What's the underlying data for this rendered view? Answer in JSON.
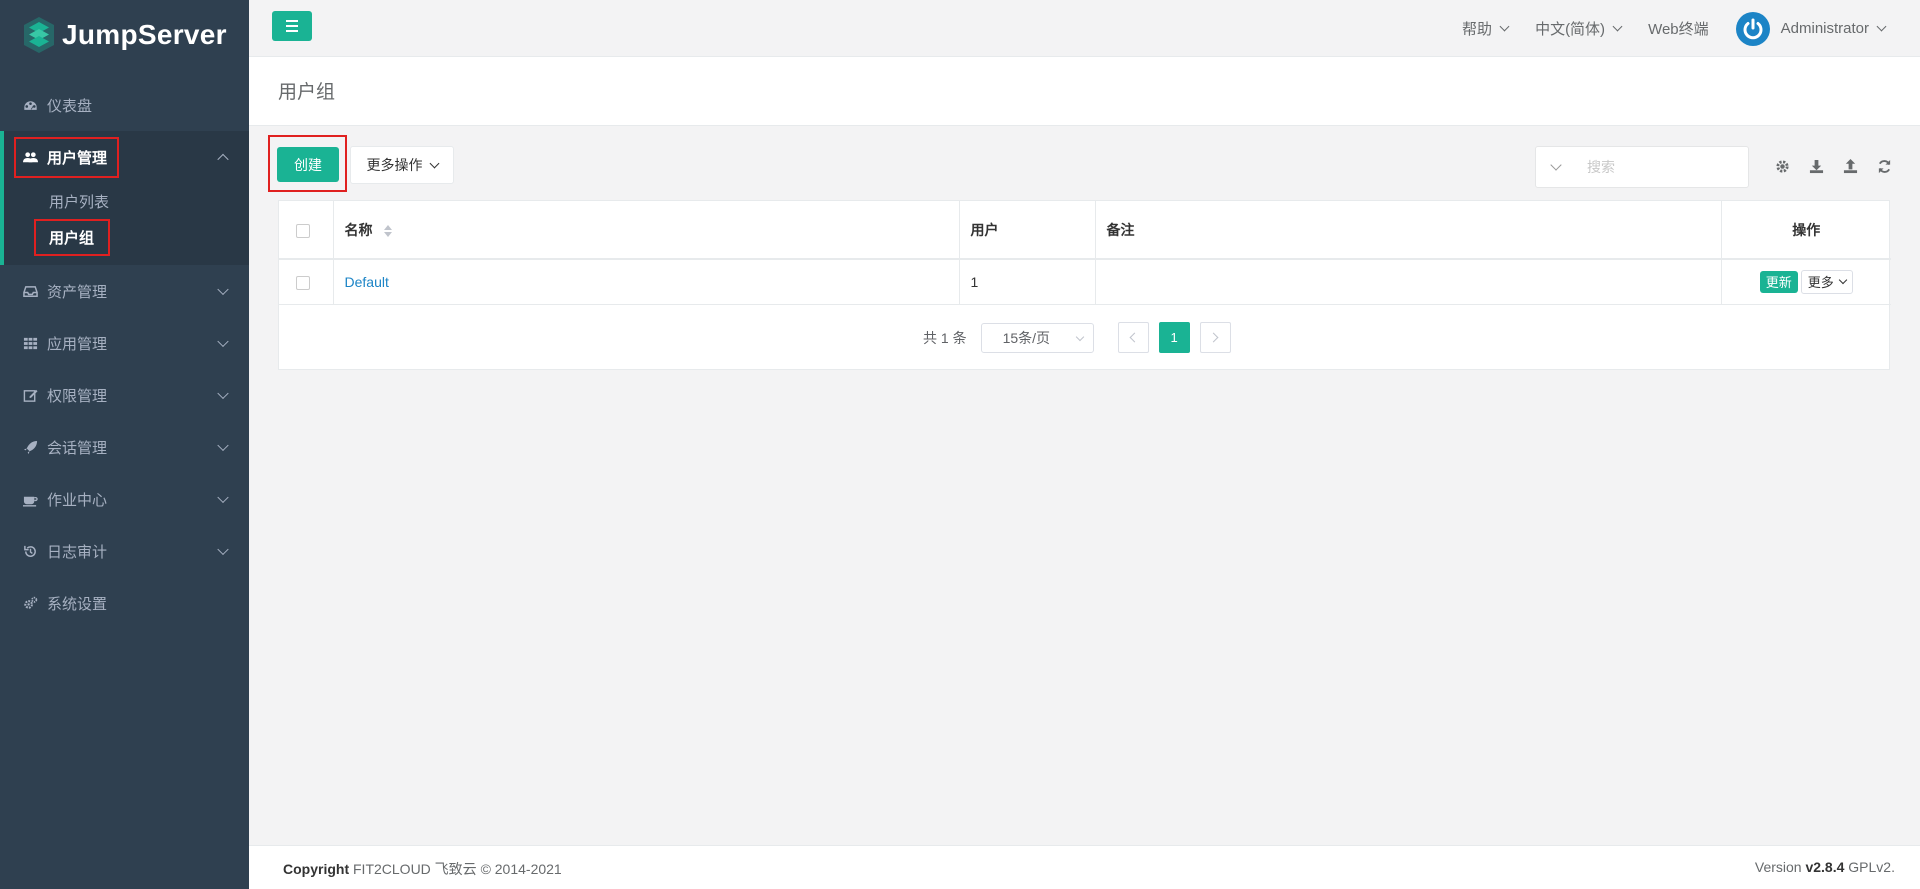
{
  "brand": {
    "name": "JumpServer"
  },
  "sidebar": {
    "items": [
      {
        "label": "仪表盘",
        "icon": "dashboard-icon"
      },
      {
        "label": "用户管理",
        "icon": "users-icon",
        "children": [
          {
            "label": "用户列表"
          },
          {
            "label": "用户组"
          }
        ]
      },
      {
        "label": "资产管理",
        "icon": "inbox-icon"
      },
      {
        "label": "应用管理",
        "icon": "grid-icon"
      },
      {
        "label": "权限管理",
        "icon": "edit-icon"
      },
      {
        "label": "会话管理",
        "icon": "rocket-icon"
      },
      {
        "label": "作业中心",
        "icon": "coffee-icon"
      },
      {
        "label": "日志审计",
        "icon": "history-icon"
      },
      {
        "label": "系统设置",
        "icon": "gears-icon"
      }
    ]
  },
  "topbar": {
    "help": "帮助",
    "language": "中文(简体)",
    "web_terminal": "Web终端",
    "user": "Administrator"
  },
  "page": {
    "title": "用户组"
  },
  "toolbar": {
    "create_label": "创建",
    "more_actions_label": "更多操作",
    "search_placeholder": "搜索"
  },
  "table": {
    "headers": {
      "name": "名称",
      "users": "用户",
      "comment": "备注",
      "actions": "操作"
    },
    "rows": [
      {
        "name": "Default",
        "users": "1",
        "comment": "",
        "update": "更新",
        "more": "更多"
      }
    ]
  },
  "pagination": {
    "total": "共 1 条",
    "page_size": "15条/页",
    "current_page": "1"
  },
  "footer": {
    "copyright_label": "Copyright",
    "copyright_text": "FIT2CLOUD 飞致云 © 2014-2021",
    "version_label": "Version",
    "version": "v2.8.4",
    "license": "GPLv2."
  },
  "colors": {
    "accent": "#1ab394",
    "sidebar": "#2f4050",
    "link": "#1c84c6",
    "highlight": "#e02020"
  }
}
